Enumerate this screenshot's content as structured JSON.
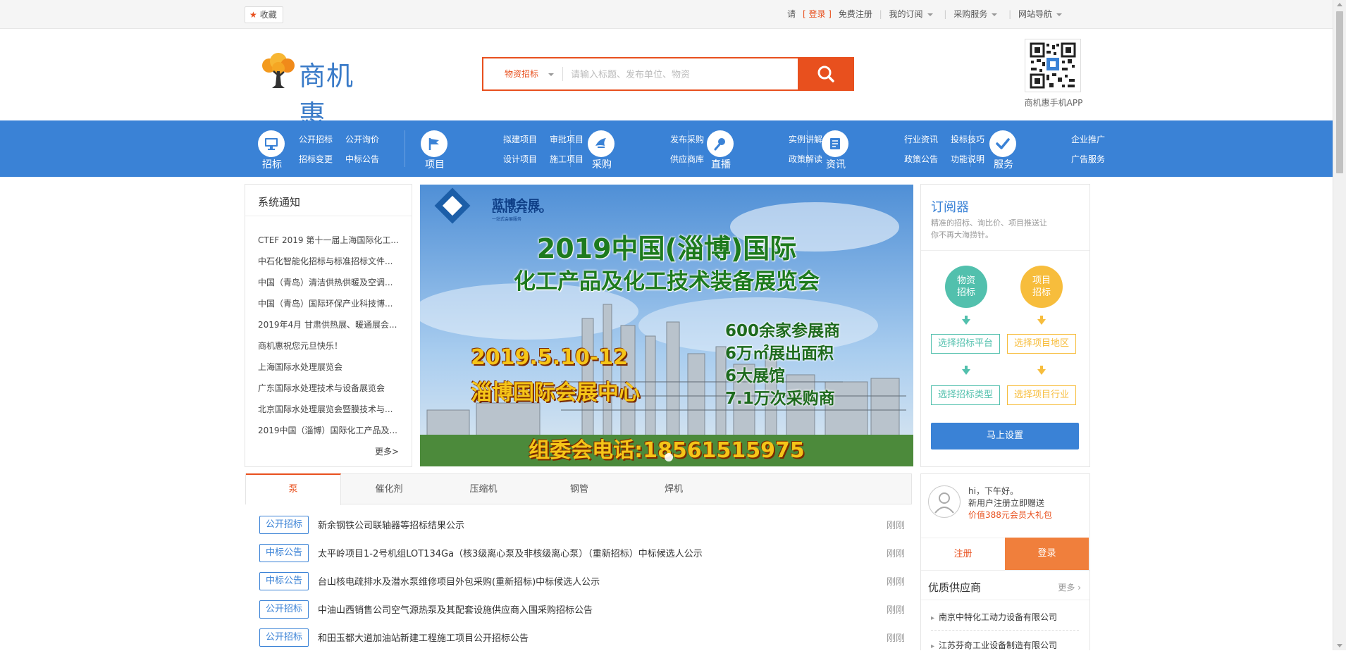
{
  "topbar": {
    "favorite": "收藏",
    "please": "请",
    "login": "[ 登录 ]",
    "register": "免费注册",
    "my_subscription": "我的订阅",
    "procurement_service": "采购服务",
    "site_nav": "网站导航"
  },
  "header": {
    "logo_text": "商机惠",
    "search_category": "物资招标",
    "search_placeholder": "请输入标题、发布单位、物资",
    "qr_label": "商机惠手机APP"
  },
  "nav": [
    {
      "label": "招标",
      "icon": "monitor-icon",
      "links": [
        "公开招标",
        "公开询价",
        "招标变更",
        "中标公告"
      ]
    },
    {
      "label": "项目",
      "icon": "flag-icon",
      "links": [
        "拟建项目",
        "审批项目",
        "设计项目",
        "施工项目"
      ]
    },
    {
      "label": "采购",
      "icon": "cart-icon",
      "links": [
        "发布采购",
        "供应商库"
      ]
    },
    {
      "label": "直播",
      "icon": "microphone-icon",
      "links": [
        "实例讲解",
        "政策解读"
      ]
    },
    {
      "label": "资讯",
      "icon": "document-icon",
      "links": [
        "行业资讯",
        "投标技巧",
        "政策公告",
        "功能说明"
      ]
    },
    {
      "label": "服务",
      "icon": "checkmark-icon",
      "links": [
        "企业推广",
        "广告服务"
      ]
    }
  ],
  "notice": {
    "title": "系统通知",
    "items": [
      "CTEF 2019 第十一届上海国际化工...",
      "中石化智能化招标与标准招标文件...",
      "中国（青岛）清洁供热供暖及空调...",
      "中国（青岛）国际环保产业科技博...",
      "2019年4月 甘肃供热展、暖通展会...",
      "商机惠祝您元旦快乐！",
      "上海国际水处理展览会",
      "广东国际水处理技术与设备展览会",
      "北京国际水处理展览会暨膜技术与...",
      "2019中国（淄博）国际化工产品及..."
    ],
    "more": "更多>"
  },
  "banner": {
    "brand_cn": "蓝博会展",
    "brand_en": "LANBO EXPO",
    "brand_slogan": "一站式会展服务",
    "title_line1": "2019中国(淄博)国际",
    "title_line2": "化工产品及化工技术装备展览会",
    "date": "2019.5.10-12",
    "venue": "淄博国际会展中心",
    "facts": [
      "600余家参展商",
      "6万㎡展出面积",
      "6大展馆",
      "7.1万次采购商"
    ],
    "phone": "组委会电话:18561515975"
  },
  "subscribe": {
    "title": "订阅器",
    "desc": "精准的招标、询比价、项目推送让你不再大海捞针。",
    "circle_left": "物资招标",
    "circle_right": "项目招标",
    "left_step1": "选择招标平台",
    "left_step2": "选择招标类型",
    "right_step1": "选择项目地区",
    "right_step2": "选择项目行业",
    "button": "马上设置",
    "color_teal": "#52c0ad",
    "color_yellow": "#f7bd3c"
  },
  "tabs": [
    "泵",
    "催化剂",
    "压缩机",
    "钢管",
    "焊机"
  ],
  "listings": [
    {
      "type": "公开招标",
      "title": "新余钢铁公司联轴器等招标结果公示",
      "time": "刚刚"
    },
    {
      "type": "中标公告",
      "title": "太平岭项目1-2号机组LOT134Ga（核3级离心泵及非核级离心泵）（重新招标）中标候选人公示",
      "time": "刚刚"
    },
    {
      "type": "中标公告",
      "title": "台山核电疏排水及潜水泵维修项目外包采购(重新招标)中标候选人公示",
      "time": "刚刚"
    },
    {
      "type": "公开招标",
      "title": "中油山西销售公司空气源热泵及其配套设施供应商入围采购招标公告",
      "time": "刚刚"
    },
    {
      "type": "公开招标",
      "title": "和田玉都大道加油站新建工程施工项目公开招标公告",
      "time": "刚刚"
    }
  ],
  "user": {
    "greeting": "hi，下午好。",
    "promo1": "新用户注册立即赠送",
    "promo2": "价值388元会员大礼包",
    "register": "注册",
    "login": "登录"
  },
  "suppliers": {
    "title": "优质供应商",
    "more": "更多",
    "items": [
      "南京中特化工动力设备有限公司",
      "江苏芬奇工业设备制造有限公司"
    ]
  },
  "colors": {
    "accent": "#e8501e",
    "primary": "#3a82d6"
  }
}
